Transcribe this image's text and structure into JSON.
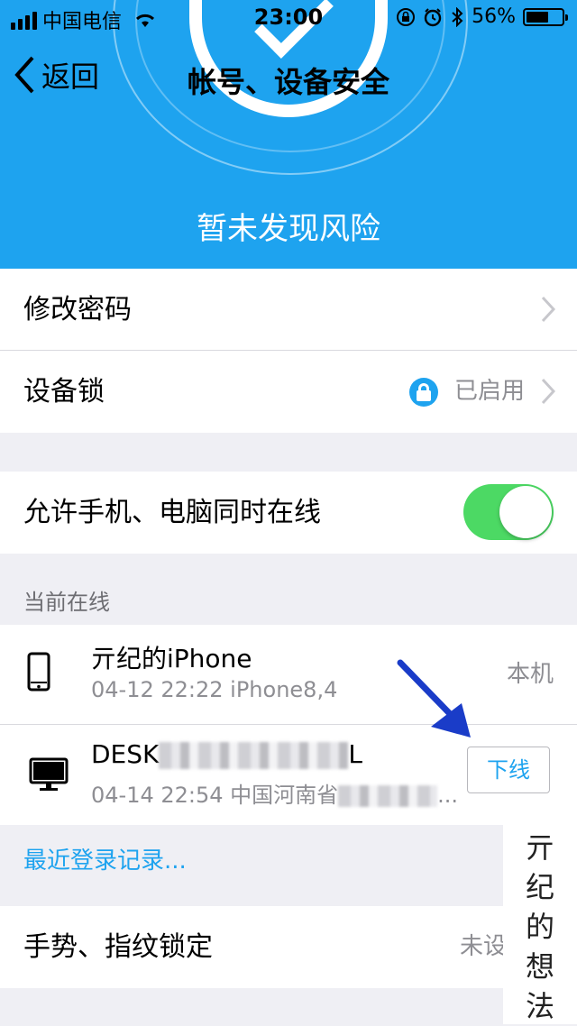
{
  "status_bar": {
    "carrier": "中国电信",
    "time": "23:00",
    "battery": "56%"
  },
  "nav": {
    "back_label": "返回",
    "title": "帐号、设备安全"
  },
  "header": {
    "risk_text": "暂未发现风险"
  },
  "group1": {
    "change_password": "修改密码",
    "device_lock": "设备锁",
    "device_lock_status": "已启用"
  },
  "group2": {
    "allow_online": "允许手机、电脑同时在线",
    "allow_online_on": true
  },
  "online": {
    "section_title": "当前在线",
    "devices": [
      {
        "name": "亓纪的iPhone",
        "meta": "04-12 22:22  iPhone8,4",
        "tag": "本机"
      },
      {
        "name_prefix": "DESK",
        "name_suffix": "L",
        "meta_prefix": "04-14 22:54 中国河南省",
        "meta_suffix": "...",
        "action": "下线"
      }
    ],
    "recent_link": "最近登录记录..."
  },
  "group3": {
    "gesture_lock": "手势、指纹锁定",
    "gesture_status": "未设"
  },
  "watermark": {
    "chars": [
      "亓",
      "纪",
      "的",
      "想",
      "法"
    ]
  },
  "colors": {
    "header_blue": "#1ea3ef",
    "toggle_green": "#4cd964",
    "annotation_arrow": "#1a3cc8"
  }
}
